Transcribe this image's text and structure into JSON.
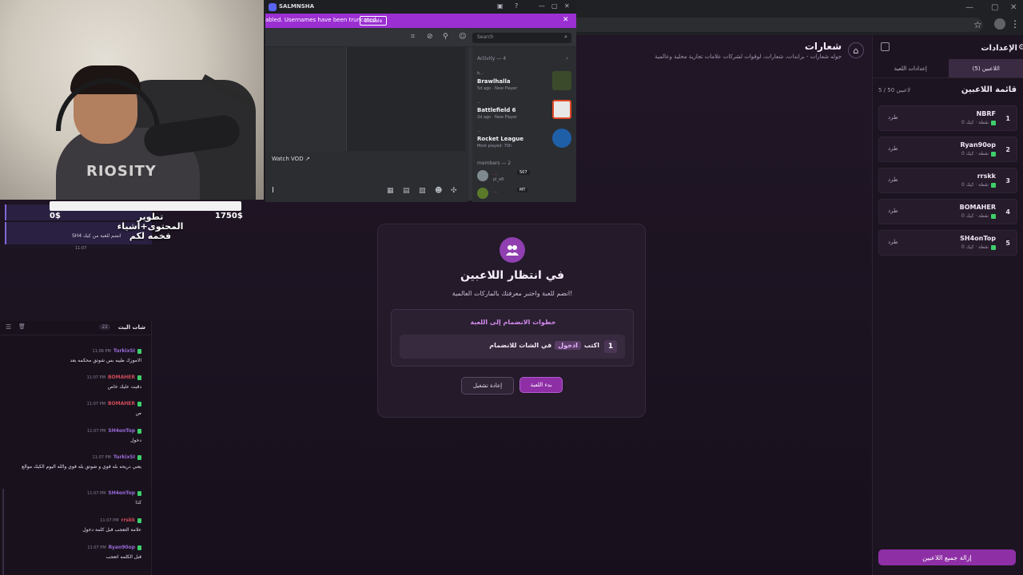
{
  "browser": {
    "star": "☆",
    "menu": "⋮"
  },
  "header": {
    "title": "شعارات",
    "subtitle": "جوله شعارات - براندات، شعارات، لوقوات لشركات علامات تجارية محلية وعالمية"
  },
  "sidebar": {
    "title": "الإعدادات",
    "tabs": [
      {
        "label": "اللاعبين (5)",
        "active": true
      },
      {
        "label": "إعدادات اللعبة",
        "active": false
      }
    ],
    "list_title": "قائمة اللاعبين",
    "count": "5 / 50 لاعبين",
    "players": [
      {
        "rank": "1",
        "name": "NBRF",
        "score": "0 نقطة · كيك",
        "kick": "طرد"
      },
      {
        "rank": "2",
        "name": "Ryan90op",
        "score": "0 نقطة · كيك",
        "kick": "طرد"
      },
      {
        "rank": "3",
        "name": "rrskk",
        "score": "0 نقطة · كيك",
        "kick": "طرد"
      },
      {
        "rank": "4",
        "name": "BOMAHER",
        "score": "0 نقطة · كيك",
        "kick": "طرد"
      },
      {
        "rank": "5",
        "name": "SH4onTop",
        "score": "0 نقطة · كيك",
        "kick": "طرد"
      }
    ],
    "remove_all": "إزالة جميع اللاعبين"
  },
  "card": {
    "title": "في انتظار اللاعبين",
    "subtitle": "انضم للعبة واختبر معرفتك بالماركات العالمية!",
    "steps_title": "خطوات الانضمام إلى اللعبة",
    "step1_num": "1",
    "step1_pre": "اكتب",
    "step1_kw": "ادخول",
    "step1_post": "في الشات للانضمام",
    "start_label": "بدء اللعبة",
    "restart_label": "إعادة تشغيل"
  },
  "cam": {
    "shirt_text": "RIOSITY"
  },
  "donation": {
    "left": "0$",
    "right": "1750$",
    "label": "تطوير المحتوى+أشياء فخمه لكم",
    "progress": 0
  },
  "mini_chat": {
    "text": "SH4 انضم للعبة من كيك",
    "time": "11:07",
    "top_time": "11:07"
  },
  "discord": {
    "app_name": "SALMNSHA",
    "banner": "abled. Usernames have been truncated.",
    "disable": "Disable",
    "search_placeholder": "Search",
    "watch_vod": "Watch VOD",
    "activity_header": "Activity — 4",
    "games": [
      {
        "user": "b...",
        "name": "Brawlhalla",
        "meta": "5d ago · New Player"
      },
      {
        "user": "...",
        "name": "Battlefield 6",
        "meta": "2d ago · New Player"
      },
      {
        "user": "...",
        "name": "Rocket League",
        "meta": "Most played: 70h"
      }
    ],
    "members_header": "members — 2",
    "members": [
      {
        "name": "...",
        "tag": "507",
        "sub": "pl_e8"
      },
      {
        "name": "...",
        "tag": "MT",
        "sub": ""
      }
    ]
  },
  "chat": {
    "title": "شات البث",
    "count": "22",
    "messages": [
      {
        "user": "TurkixSI",
        "time": "11:06 PM",
        "text": "الاموزك طيبه بس شوتق محكمه بعد"
      },
      {
        "user": "BOMAHER",
        "time": "11:07 PM",
        "text": "دقيت عليك خاص"
      },
      {
        "user": "BOMAHER",
        "time": "11:07 PM",
        "text": "ص"
      },
      {
        "user": "SH4onTop",
        "time": "11:07 PM",
        "text": "دخول"
      },
      {
        "user": "TurkixSI",
        "time": "11:07 PM",
        "text": "يعني دريحه بله قوي و شوتق بله قوي والله اليوم الكيك موالع"
      },
      {
        "user": "SH4onTop",
        "time": "11:07 PM",
        "text": "كذا"
      },
      {
        "user": "rrskk",
        "time": "11:07 PM",
        "text": "علامة التعجب قبل كلمة دخول"
      },
      {
        "user": "Ryan90op",
        "time": "11:07 PM",
        "text": "قبل الكلمه اتعجب"
      }
    ]
  }
}
